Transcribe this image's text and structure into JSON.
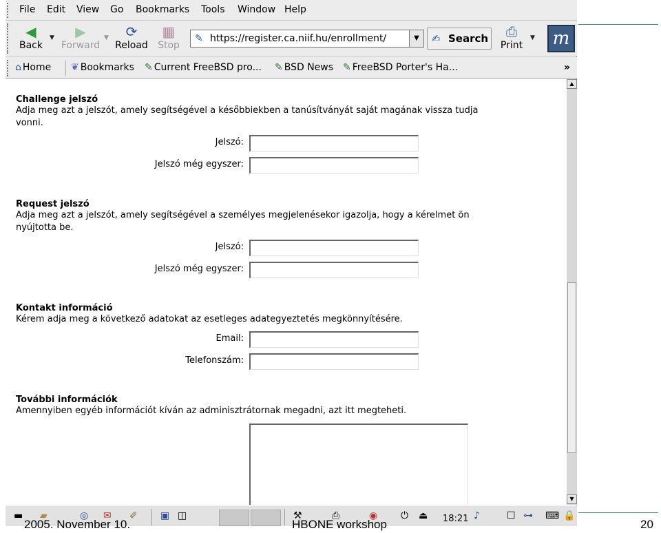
{
  "menu": {
    "file": "File",
    "edit": "Edit",
    "view": "View",
    "go": "Go",
    "bookmarks": "Bookmarks",
    "tools": "Tools",
    "window": "Window",
    "help": "Help"
  },
  "toolbar": {
    "back": "Back",
    "forward": "Forward",
    "reload": "Reload",
    "stop": "Stop",
    "url": "https://register.ca.niif.hu/enrollment/",
    "search": "Search",
    "print": "Print"
  },
  "bookmarks_bar": {
    "home": "Home",
    "bookmarks": "Bookmarks",
    "items": [
      "Current FreeBSD pro...",
      "BSD News",
      "FreeBSD Porter's Ha..."
    ],
    "more": "»"
  },
  "content": {
    "challenge": {
      "title": "Challenge jelszó",
      "desc1": "Adja meg azt a jelszót, amely segítségével a későbbiekben a tanúsítványát saját magának vissza tudja",
      "desc2": "vonni.",
      "password_label": "Jelszó:",
      "password_repeat_label": "Jelszó még egyszer:"
    },
    "request": {
      "title": "Request jelszó",
      "desc1": "Adja meg azt a jelszót, amely segítségével a személyes megjelenésekor igazolja, hogy a kérelmet ön",
      "desc2": "nyújtotta be.",
      "password_label": "Jelszó:",
      "password_repeat_label": "Jelszó még egyszer:"
    },
    "contact": {
      "title": "Kontakt információ",
      "desc1": "Kérem adja meg a következő adatokat az esetleges adategyeztetés megkönnyítésére.",
      "email_label": "Email:",
      "phone_label": "Telefonszám:"
    },
    "further": {
      "title": "További információk",
      "desc1": "Amennyiben egyéb információt kíván az adminisztrátornak megadni, azt itt megteheti."
    }
  },
  "taskbar": {
    "clock": "18:21"
  },
  "footer": {
    "date": "2005. November 10.",
    "event": "HBONE workshop",
    "page": "20"
  },
  "colors": {
    "accent_line": "#3a8a8a",
    "logo_bg": "#3c5c86"
  }
}
